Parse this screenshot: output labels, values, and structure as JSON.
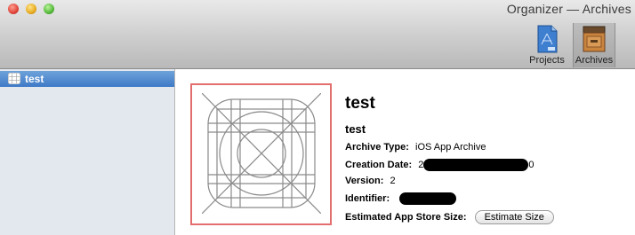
{
  "window": {
    "title": "Organizer — Archives"
  },
  "toolbar": {
    "projects_label": "Projects",
    "archives_label": "Archives"
  },
  "sidebar": {
    "items": [
      {
        "label": "test",
        "selected": true
      }
    ]
  },
  "archive": {
    "title": "test",
    "name": "test",
    "archive_type_label": "Archive Type:",
    "archive_type_value": "iOS App Archive",
    "creation_date_label": "Creation Date:",
    "creation_date_visible_start": "2",
    "creation_date_visible_end": "0",
    "version_label": "Version:",
    "version_value": "2",
    "identifier_label": "Identifier:",
    "estimated_size_label": "Estimated App Store Size:",
    "estimate_button_label": "Estimate Size"
  },
  "colors": {
    "selection": "#3e79c7",
    "sidebar_bg": "#e3e8ef",
    "icon_frame_border": "#e26e6e"
  }
}
